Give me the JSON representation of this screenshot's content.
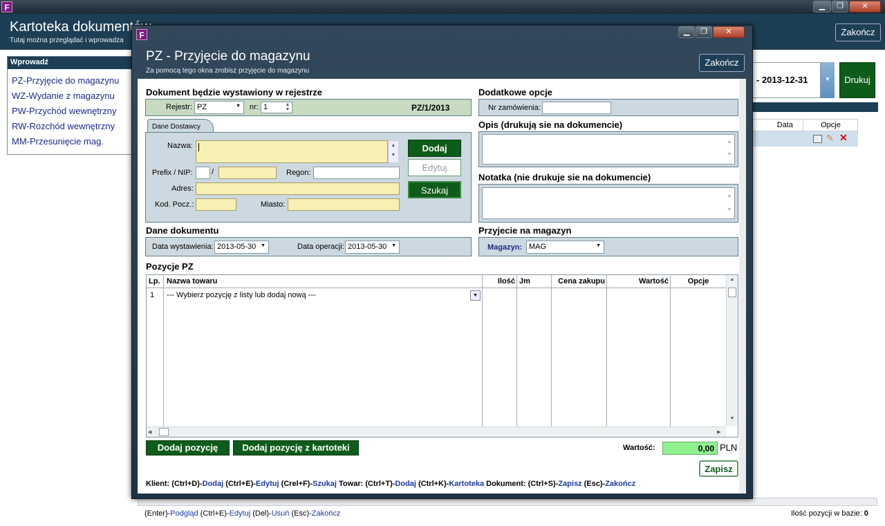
{
  "main_window": {
    "title": "Kartoteka dokumentów",
    "subtitle": "Tutaj można przeglądać i wprowadza",
    "close_label": "Zakończ",
    "print_label": "Drukuj",
    "date_to": "- 2013-12-31",
    "table_headers": {
      "date": "Data",
      "options": "Opcje"
    },
    "footer_left": [
      {
        "t": "(Enter)-",
        "k": false
      },
      {
        "t": "Podgląd",
        "k": true
      },
      {
        "t": " (Ctrl+E)-",
        "k": false
      },
      {
        "t": "Edytuj",
        "k": true
      },
      {
        "t": " (Del)-",
        "k": false
      },
      {
        "t": "Usuń",
        "k": true
      },
      {
        "t": " (Esc)-",
        "k": false
      },
      {
        "t": "Zakończ",
        "k": true
      }
    ],
    "count_label": "Ilość pozycji w bazie:",
    "count_value": "0"
  },
  "sidebar": {
    "title": "Wprowadź",
    "items": [
      "PZ-Przyjęcie do magazynu",
      "WZ-Wydanie z magazynu",
      "PW-Przychód wewnętrzny",
      "RW-Rozchód wewnętrzny",
      "MM-Przesunięcie mag."
    ]
  },
  "dialog": {
    "title": "PZ - Przyjęcie do magazynu",
    "subtitle": "Za pomocą tego okna zrobisz przyjęcie do magazynu",
    "close_label": "Zakończ",
    "register": {
      "section_title": "Dokument będzie wystawiony w rejestrze",
      "registry_label": "Rejestr:",
      "registry_value": "PZ",
      "nr_label": "nr:",
      "nr_value": "1",
      "doc_number": "PZ/1/2013"
    },
    "supplier": {
      "tab_label": "Dane Dostawcy",
      "name_label": "Nazwa:",
      "name_value": "",
      "prefix_label": "Prefix / NIP:",
      "slash": "/",
      "regon_label": "Regon:",
      "address_label": "Adres:",
      "postal_label": "Kod. Pocz.:",
      "city_label": "Miasto:",
      "add_btn": "Dodaj",
      "edit_btn": "Edytuj",
      "search_btn": "Szukaj"
    },
    "document": {
      "section_title": "Dane dokumentu",
      "issue_label": "Data wystawienia:",
      "issue_value": "2013-05-30",
      "op_label": "Data operacji:",
      "op_value": "2013-05-30"
    },
    "extra": {
      "section_title": "Dodatkowe opcje",
      "order_label": "Nr zamówienia:",
      "order_value": ""
    },
    "desc": {
      "section_title": "Opis (drukują sie na dokumencie)",
      "value": ""
    },
    "note": {
      "section_title": "Notatka (nie drukuje sie na dokumencie)",
      "value": ""
    },
    "warehouse": {
      "section_title": "Przyjecie na magazyn",
      "label": "Magazyn:",
      "value": "MAG"
    },
    "positions": {
      "section_title": "Pozycje PZ",
      "headers": {
        "lp": "Lp.",
        "name": "Nazwa towaru",
        "qty": "Ilość",
        "unit": "Jm",
        "price": "Cena zakupu",
        "value": "Wartość",
        "options": "Opcje"
      },
      "rows": [
        {
          "lp": "1",
          "name": "--- Wybierz pozycję z listy lub dodaj nową ---"
        }
      ]
    },
    "add_pos_btn": "Dodaj pozycję",
    "add_pos_catalog_btn": "Dodaj pozycję z kartoteki",
    "total_label": "Wartość:",
    "total_value": "0,00",
    "currency": "PLN",
    "save_btn": "Zapisz",
    "help": [
      {
        "t": "Klient: (Ctrl+D)-",
        "k": false
      },
      {
        "t": "Dodaj",
        "k": true
      },
      {
        "t": " (Ctrl+E)-",
        "k": false
      },
      {
        "t": "Edytuj",
        "k": true
      },
      {
        "t": " (Crel+F)-",
        "k": false
      },
      {
        "t": "Szukaj",
        "k": true
      },
      {
        "t": "  Towar: (Ctrl+T)-",
        "k": false
      },
      {
        "t": "Dodaj",
        "k": true
      },
      {
        "t": " (Ctrl+K)-",
        "k": false
      },
      {
        "t": "Kartoteka",
        "k": true
      },
      {
        "t": "  Dokument: (Ctrl+S)-",
        "k": false
      },
      {
        "t": "Zapisz",
        "k": true
      },
      {
        "t": " (Esc)-",
        "k": false
      },
      {
        "t": "Zakończ",
        "k": true
      }
    ]
  },
  "colors": {
    "header_bg": "#1d3f55",
    "green_button": "#0e5c1a",
    "panel_bg": "#cdd9e0",
    "input_yellow": "#f8efb4",
    "total_green": "#90f090"
  }
}
